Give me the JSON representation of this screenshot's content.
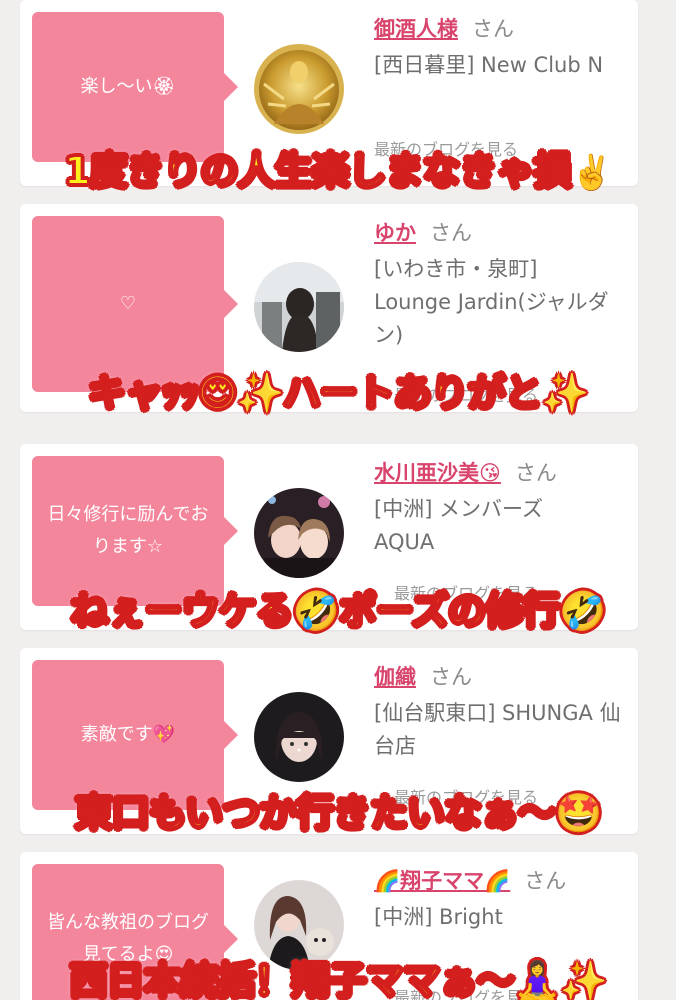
{
  "cards": [
    {
      "message": "楽し〜い🏵",
      "name": "御酒人様",
      "san": "さん",
      "shop": "[西日暮里] New Club N",
      "blog_link": "最新のブログを見る",
      "caption": "1度きりの人生楽しまなきゃ損",
      "caption_emoji": "✌️",
      "avatar_icon": "golden-buddha-statue"
    },
    {
      "message": "♡",
      "name": "ゆか",
      "san": "さん",
      "shop": "[いわき市・泉町] Lounge Jardin(ジャルダン)",
      "blog_link": "最新のブログを見る",
      "caption": "キャｯｯ😍✨ハートありがと✨",
      "avatar_icon": "woman-photo"
    },
    {
      "message": "日々修行に励んでおります☆",
      "name": "水川亜沙美😘",
      "san": "さん",
      "shop": "[中洲] メンバーズAQUA",
      "blog_link": "最新のブログを見る",
      "caption": "ねぇーウケる🤣ポーズの修行🤣",
      "avatar_icon": "two-women-photo"
    },
    {
      "message": "素敵です💖",
      "name": "伽織",
      "san": "さん",
      "shop": "[仙台駅東口] SHUNGA 仙台店",
      "blog_link": "最新のブログを見る",
      "caption": "東口もいつか行きたいなぁ〜🤩",
      "avatar_icon": "woman-portrait-photo"
    },
    {
      "message": "皆んな教祖のブログ見てるよ😍",
      "name": "🌈翔子ママ🌈",
      "san": "さん",
      "shop": "[中洲] Bright",
      "blog_link": "最新のブログを見る",
      "caption": "西日本統括！翔子ママぁ〜🧘‍♀️✨",
      "avatar_icon": "woman-with-dog-photo"
    }
  ],
  "colors": {
    "bubble": "#f4869c",
    "name": "#d9446c",
    "caption_fill": "#ffef1a",
    "caption_stroke": "#d41f1f"
  }
}
